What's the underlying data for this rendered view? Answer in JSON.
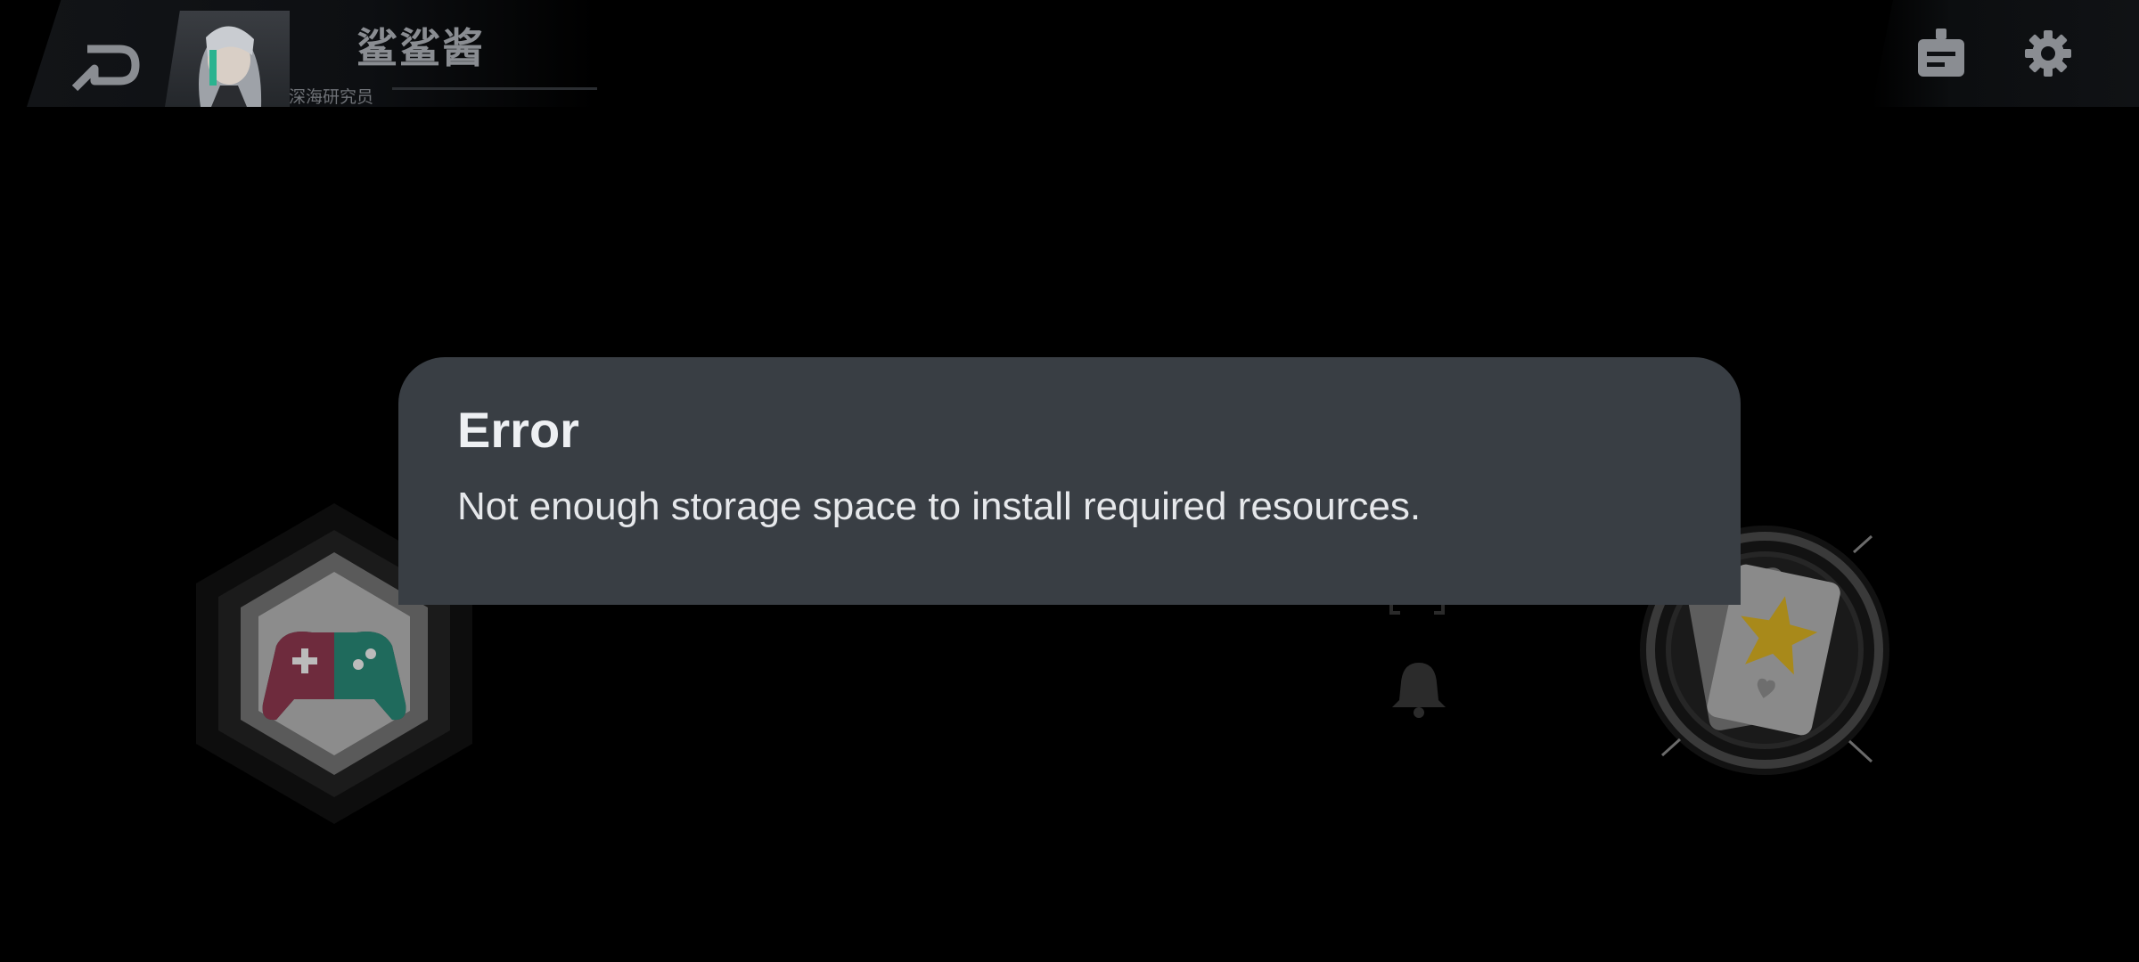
{
  "header": {
    "username": "鲨鲨酱",
    "user_title": "深海研究员"
  },
  "dialog": {
    "title": "Error",
    "message": "Not enough storage space to install required resources."
  },
  "icons": {
    "back": "back-arrow-icon",
    "mail": "mailbox-icon",
    "settings": "gear-icon",
    "game": "gamepad-icon",
    "notifications": "bell-icon",
    "cards": "star-card-icon"
  },
  "colors": {
    "dialog_bg": "#393e44",
    "gamepad_left": "#e0436b",
    "gamepad_right": "#2dbfa0",
    "star": "#f2c41a"
  }
}
